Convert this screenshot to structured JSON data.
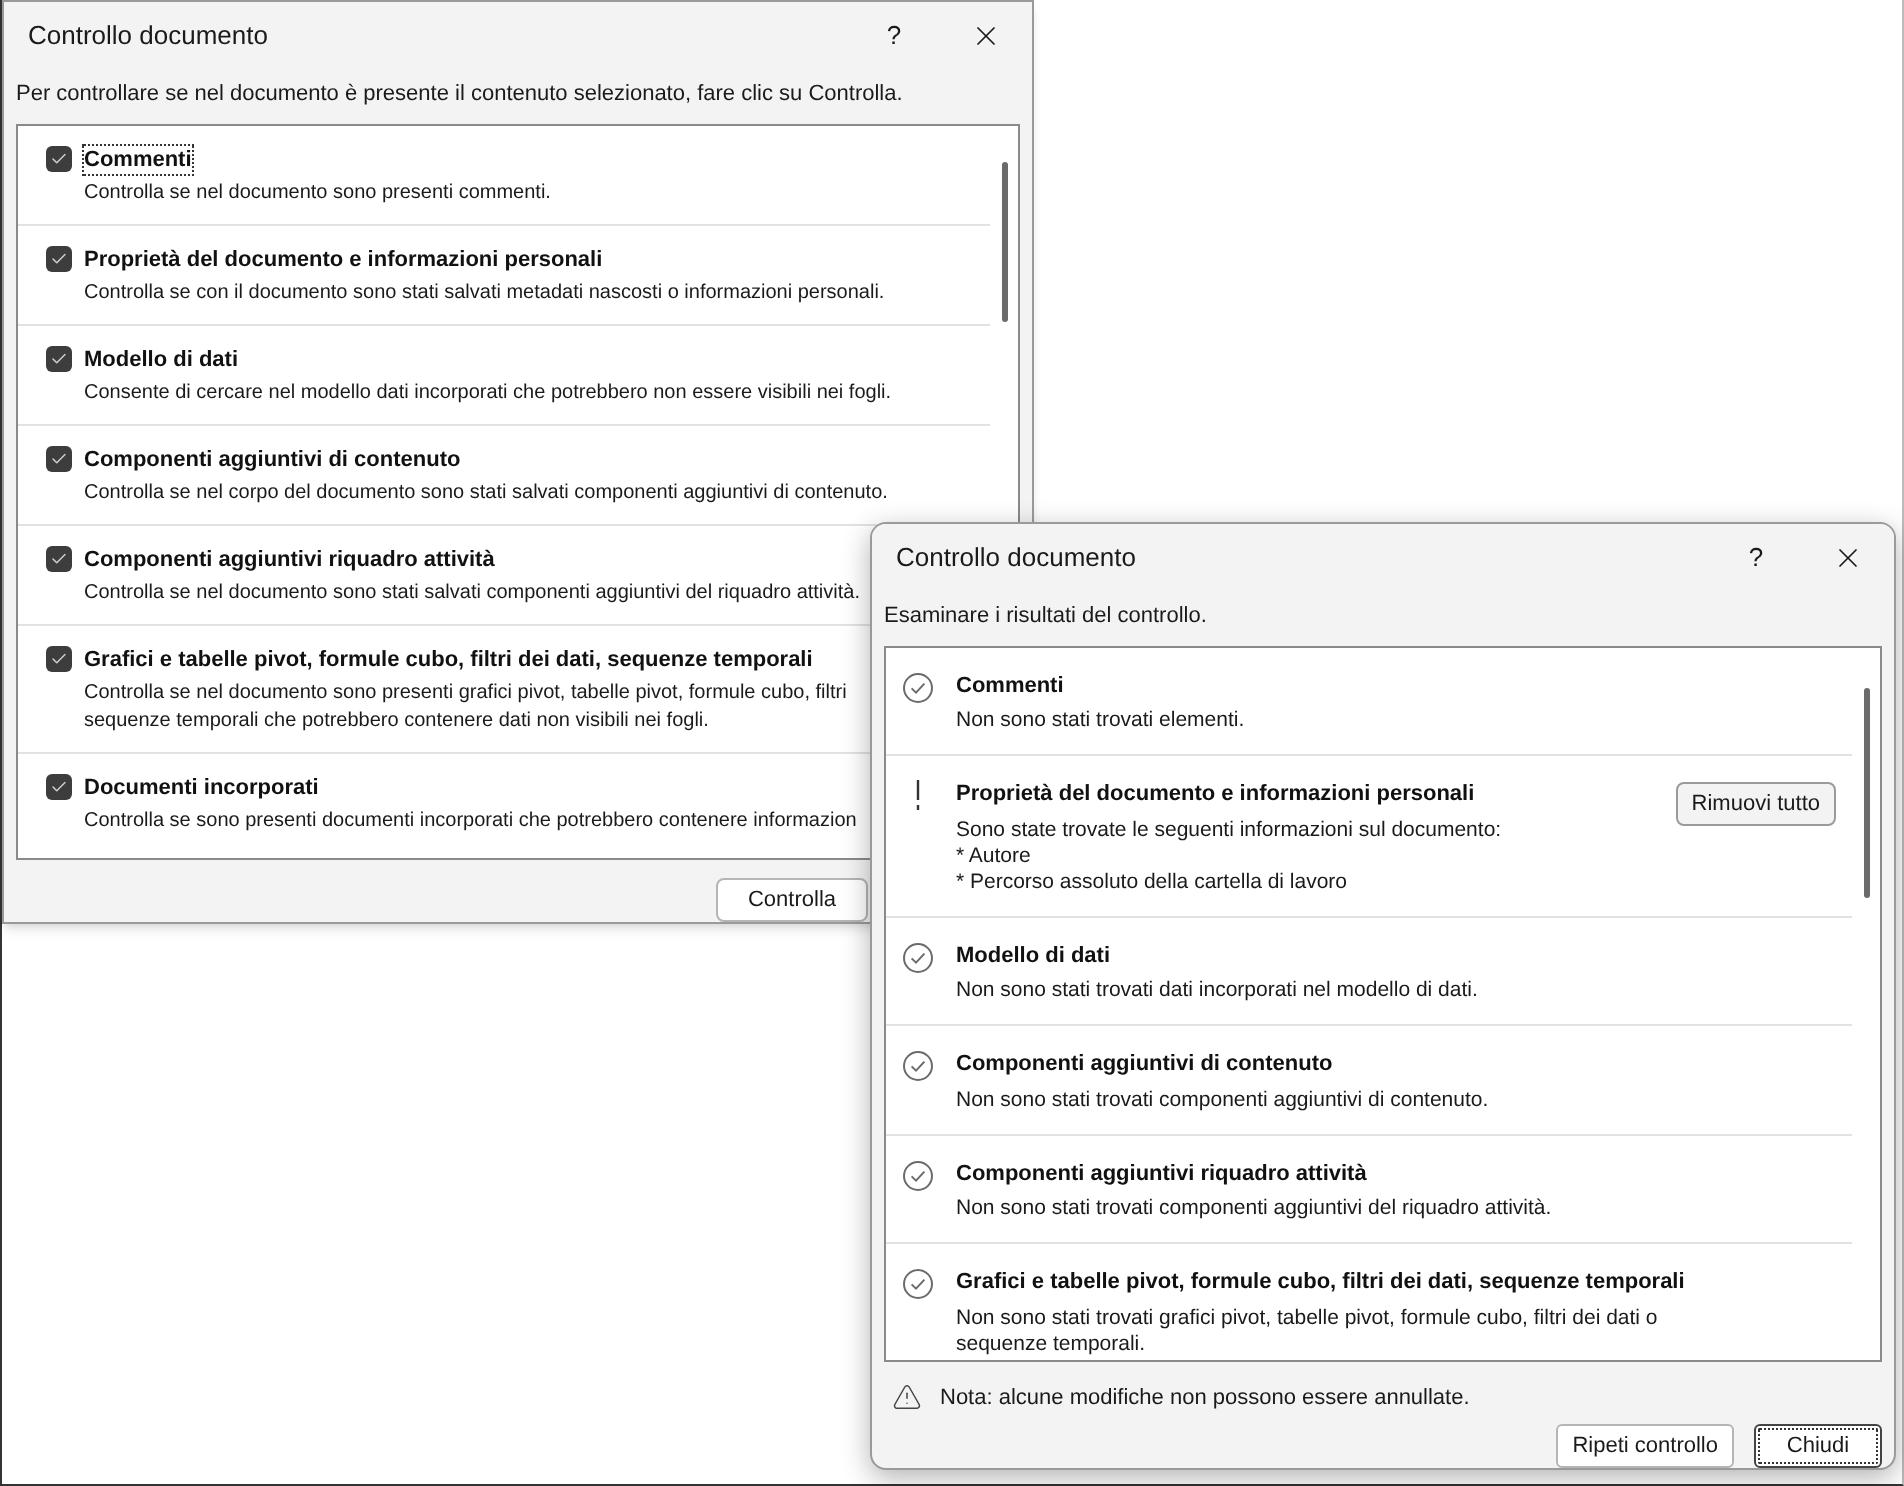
{
  "inspect_dialog": {
    "title": "Controllo documento",
    "help_button": "?",
    "instruction": "Per controllare se nel documento è presente il contenuto selezionato, fare clic su Controlla.",
    "items": [
      {
        "label": "Commenti",
        "lines": [
          "Controlla se nel documento sono presenti commenti."
        ],
        "checked": true,
        "focused": true
      },
      {
        "label": "Proprietà del documento e informazioni personali",
        "lines": [
          "Controlla se con il documento sono stati salvati metadati nascosti o informazioni personali."
        ],
        "checked": true,
        "focused": false
      },
      {
        "label": "Modello di dati",
        "lines": [
          "Consente di cercare nel modello dati incorporati che potrebbero non essere visibili nei fogli."
        ],
        "checked": true,
        "focused": false
      },
      {
        "label": "Componenti aggiuntivi di contenuto",
        "lines": [
          "Controlla se nel corpo del documento sono stati salvati componenti aggiuntivi di contenuto."
        ],
        "checked": true,
        "focused": false
      },
      {
        "label": "Componenti aggiuntivi riquadro attività",
        "lines": [
          "Controlla se nel documento sono stati salvati componenti aggiuntivi del riquadro attività."
        ],
        "checked": true,
        "focused": false
      },
      {
        "label": "Grafici e tabelle pivot, formule cubo, filtri dei dati, sequenze temporali",
        "lines": [
          "Controlla se nel documento sono presenti grafici pivot, tabelle pivot, formule cubo, filtri",
          "sequenze temporali che potrebbero contenere dati non visibili nei fogli."
        ],
        "checked": true,
        "focused": false
      },
      {
        "label": "Documenti incorporati",
        "lines": [
          "Controlla se sono presenti documenti incorporati che potrebbero contenere informazion"
        ],
        "checked": true,
        "focused": false
      }
    ],
    "button": "Controlla"
  },
  "results_dialog": {
    "title": "Controllo documento",
    "help_button": "?",
    "instruction": "Esaminare i risultati del controllo.",
    "items": [
      {
        "found": false,
        "label": "Commenti",
        "lines": [
          "Non sono stati trovati elementi."
        ]
      },
      {
        "found": true,
        "label": "Proprietà del documento e informazioni personali",
        "lines": [
          "Sono state trovate le seguenti informazioni sul documento:",
          "* Autore",
          "* Percorso assoluto della cartella di lavoro"
        ],
        "action": "Rimuovi tutto"
      },
      {
        "found": false,
        "label": "Modello di dati",
        "lines": [
          "Non sono stati trovati dati incorporati nel modello di dati."
        ]
      },
      {
        "found": false,
        "label": "Componenti aggiuntivi di contenuto",
        "lines": [
          "Non sono stati trovati componenti aggiuntivi di contenuto."
        ]
      },
      {
        "found": false,
        "label": "Componenti aggiuntivi riquadro attività",
        "lines": [
          "Non sono stati trovati componenti aggiuntivi del riquadro attività."
        ]
      },
      {
        "found": false,
        "label": "Grafici e tabelle pivot, formule cubo, filtri dei dati, sequenze temporali",
        "lines": [
          "Non sono stati trovati grafici pivot, tabelle pivot, formule cubo, filtri dei dati o",
          "sequenze temporali."
        ]
      }
    ],
    "note": "Nota: alcune modifiche non possono essere annullate.",
    "buttons": [
      {
        "label": "Ripeti controllo",
        "focused": false
      },
      {
        "label": "Chiudi",
        "focused": true
      }
    ]
  }
}
